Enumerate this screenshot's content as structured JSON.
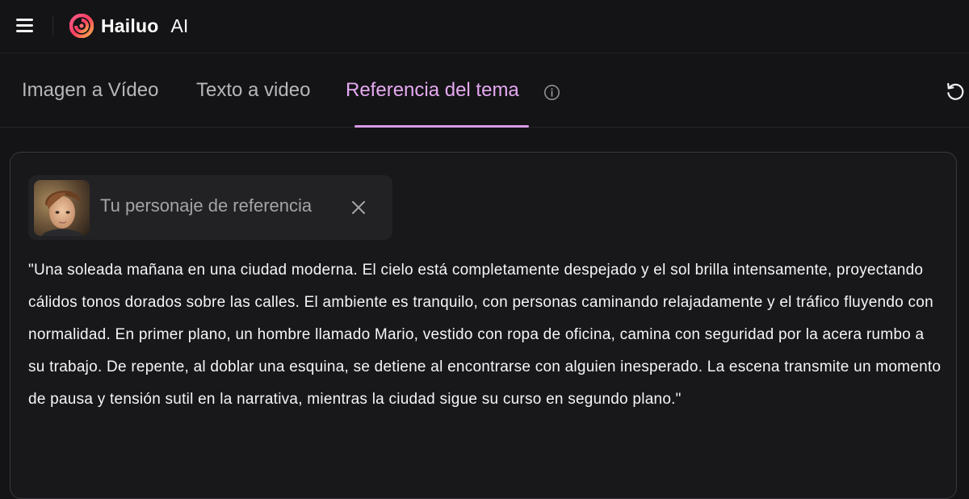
{
  "header": {
    "brand_name": "Hailuo",
    "brand_suffix": "AI",
    "menu_icon": "hamburger-menu-icon",
    "logo_icon": "hailuo-logo-icon"
  },
  "tabs": [
    {
      "label": "Imagen a Vídeo",
      "active": false
    },
    {
      "label": "Texto a video",
      "active": false
    },
    {
      "label": "Referencia del tema",
      "active": true
    }
  ],
  "tab_info_icon": "info-icon",
  "refresh_icon": "refresh-icon",
  "accent_color": "#e6a9f2",
  "reference": {
    "label": "Tu personaje de referencia",
    "avatar_icon": "character-avatar",
    "close_icon": "close-icon"
  },
  "prompt": {
    "text": "\"Una soleada mañana en una ciudad moderna. El cielo está completamente despejado y el sol brilla intensamente, proyectando cálidos tonos dorados sobre las calles. El ambiente es tranquilo, con personas caminando relajadamente y el tráfico fluyendo con normalidad. En primer plano, un hombre llamado Mario, vestido con ropa de oficina, camina con seguridad por la acera rumbo a su trabajo. De repente, al doblar una esquina, se detiene al encontrarse con alguien inesperado. La escena transmite un momento de pausa y tensión sutil en la narrativa, mientras la ciudad sigue su curso en segundo plano.\""
  }
}
